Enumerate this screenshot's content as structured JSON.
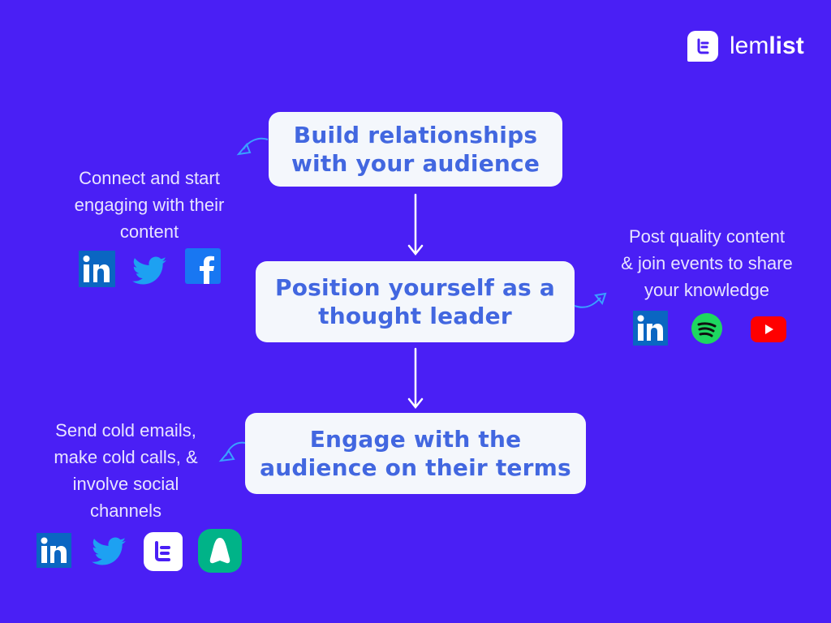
{
  "brand": {
    "name_light": "lem",
    "name_bold": "list",
    "logo_icon": "lemlist-logo-icon"
  },
  "colors": {
    "background": "#4a1ff5",
    "box_bg": "#f4f7fc",
    "box_text": "#4267e0",
    "note_text": "#e8e4ff",
    "side_arrow": "#3aa0ff"
  },
  "steps": [
    {
      "line1": "Build relationships",
      "line2": "with your audience"
    },
    {
      "line1": "Position yourself as a",
      "line2": "thought leader"
    },
    {
      "line1": "Engage with the",
      "line2": "audience on their terms"
    }
  ],
  "notes": [
    {
      "lines": [
        "Connect and start",
        "engaging with their",
        "content"
      ],
      "icons": [
        "linkedin-icon",
        "twitter-icon",
        "facebook-icon"
      ]
    },
    {
      "lines": [
        "Post quality content",
        "& join events to share",
        "your knowledge"
      ],
      "icons": [
        "linkedin-icon",
        "spotify-icon",
        "youtube-icon"
      ]
    },
    {
      "lines": [
        "Send cold emails,",
        "make cold calls, &",
        "involve social",
        "channels"
      ],
      "icons": [
        "linkedin-icon",
        "twitter-icon",
        "lemlist-icon",
        "aircall-icon"
      ]
    }
  ]
}
